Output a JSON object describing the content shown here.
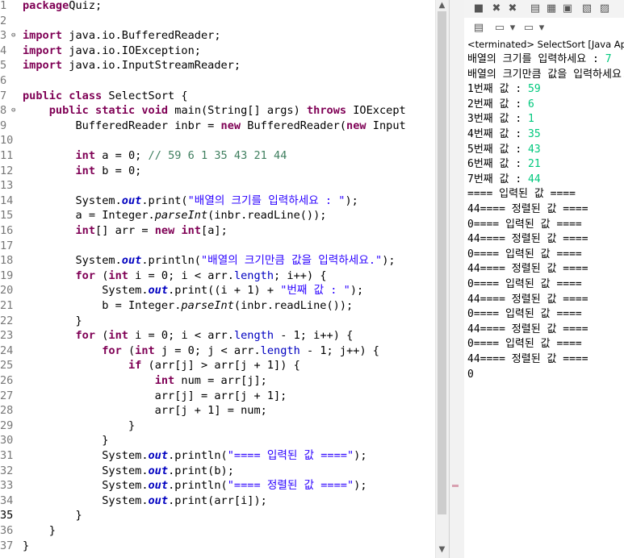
{
  "editor": {
    "lines": [
      {
        "n": "1",
        "fold": "",
        "segs": [
          [
            "kw",
            "package"
          ],
          [
            "",
            "Quiz;"
          ]
        ]
      },
      {
        "n": "2",
        "fold": "",
        "segs": []
      },
      {
        "n": "3",
        "fold": "⊖",
        "segs": [
          [
            "kw",
            "import"
          ],
          [
            "",
            " java.io.BufferedReader;"
          ]
        ]
      },
      {
        "n": "4",
        "fold": "",
        "segs": [
          [
            "kw",
            "import"
          ],
          [
            "",
            " java.io.IOException;"
          ]
        ]
      },
      {
        "n": "5",
        "fold": "",
        "segs": [
          [
            "kw",
            "import"
          ],
          [
            "",
            " java.io.InputStreamReader;"
          ]
        ]
      },
      {
        "n": "6",
        "fold": "",
        "segs": []
      },
      {
        "n": "7",
        "fold": "",
        "segs": [
          [
            "kw",
            "public class"
          ],
          [
            "",
            " SelectSort {"
          ]
        ]
      },
      {
        "n": "8",
        "fold": "⊖",
        "segs": [
          [
            "",
            "    "
          ],
          [
            "kw",
            "public static void"
          ],
          [
            "",
            " main(String[] args) "
          ],
          [
            "kw",
            "throws"
          ],
          [
            "",
            " IOExcept"
          ]
        ]
      },
      {
        "n": "9",
        "fold": "",
        "segs": [
          [
            "",
            "        BufferedReader inbr = "
          ],
          [
            "kw",
            "new"
          ],
          [
            "",
            " BufferedReader("
          ],
          [
            "kw",
            "new"
          ],
          [
            "",
            " Input"
          ]
        ]
      },
      {
        "n": "10",
        "fold": "",
        "segs": []
      },
      {
        "n": "11",
        "fold": "",
        "segs": [
          [
            "",
            "        "
          ],
          [
            "kw",
            "int"
          ],
          [
            "",
            " a = 0; "
          ],
          [
            "cm",
            "// 59 6 1 35 43 21 44"
          ]
        ]
      },
      {
        "n": "12",
        "fold": "",
        "segs": [
          [
            "",
            "        "
          ],
          [
            "kw",
            "int"
          ],
          [
            "",
            " b = 0;"
          ]
        ]
      },
      {
        "n": "13",
        "fold": "",
        "segs": []
      },
      {
        "n": "14",
        "fold": "",
        "segs": [
          [
            "",
            "        System."
          ],
          [
            "sfld",
            "out"
          ],
          [
            "",
            ".print("
          ],
          [
            "str",
            "\"배열의 크기를 입력하세요 : \""
          ],
          [
            "",
            ");"
          ]
        ]
      },
      {
        "n": "15",
        "fold": "",
        "segs": [
          [
            "",
            "        a = Integer."
          ],
          [
            "it",
            "parseInt"
          ],
          [
            "",
            "(inbr.readLine());"
          ]
        ]
      },
      {
        "n": "16",
        "fold": "",
        "segs": [
          [
            "",
            "        "
          ],
          [
            "kw",
            "int"
          ],
          [
            "",
            "[] arr = "
          ],
          [
            "kw",
            "new int"
          ],
          [
            "",
            "[a];"
          ]
        ]
      },
      {
        "n": "17",
        "fold": "",
        "segs": []
      },
      {
        "n": "18",
        "fold": "",
        "segs": [
          [
            "",
            "        System."
          ],
          [
            "sfld",
            "out"
          ],
          [
            "",
            ".println("
          ],
          [
            "str",
            "\"배열의 크기만큼 값을 입력하세요.\""
          ],
          [
            "",
            ");"
          ]
        ]
      },
      {
        "n": "19",
        "fold": "",
        "segs": [
          [
            "",
            "        "
          ],
          [
            "kw",
            "for"
          ],
          [
            "",
            " ("
          ],
          [
            "kw",
            "int"
          ],
          [
            "",
            " i = 0; i < arr."
          ],
          [
            "fld",
            "length"
          ],
          [
            "",
            "; i++) {"
          ]
        ]
      },
      {
        "n": "20",
        "fold": "",
        "segs": [
          [
            "",
            "            System."
          ],
          [
            "sfld",
            "out"
          ],
          [
            "",
            ".print((i + 1) + "
          ],
          [
            "str",
            "\"번째 값 : \""
          ],
          [
            "",
            ");"
          ]
        ]
      },
      {
        "n": "21",
        "fold": "",
        "segs": [
          [
            "",
            "            b = Integer."
          ],
          [
            "it",
            "parseInt"
          ],
          [
            "",
            "(inbr.readLine());"
          ]
        ]
      },
      {
        "n": "22",
        "fold": "",
        "segs": [
          [
            "",
            "        }"
          ]
        ]
      },
      {
        "n": "23",
        "fold": "",
        "segs": [
          [
            "",
            "        "
          ],
          [
            "kw",
            "for"
          ],
          [
            "",
            " ("
          ],
          [
            "kw",
            "int"
          ],
          [
            "",
            " i = 0; i < arr."
          ],
          [
            "fld",
            "length"
          ],
          [
            "",
            " - 1; i++) {"
          ]
        ]
      },
      {
        "n": "24",
        "fold": "",
        "segs": [
          [
            "",
            "            "
          ],
          [
            "kw",
            "for"
          ],
          [
            "",
            " ("
          ],
          [
            "kw",
            "int"
          ],
          [
            "",
            " j = 0; j < arr."
          ],
          [
            "fld",
            "length"
          ],
          [
            "",
            " - 1; j++) {"
          ]
        ]
      },
      {
        "n": "25",
        "fold": "",
        "segs": [
          [
            "",
            "                "
          ],
          [
            "kw",
            "if"
          ],
          [
            "",
            " (arr[j] > arr[j + 1]) {"
          ]
        ]
      },
      {
        "n": "26",
        "fold": "",
        "segs": [
          [
            "",
            "                    "
          ],
          [
            "kw",
            "int"
          ],
          [
            "",
            " num = arr[j];"
          ]
        ]
      },
      {
        "n": "27",
        "fold": "",
        "segs": [
          [
            "",
            "                    arr[j] = arr[j + 1];"
          ]
        ]
      },
      {
        "n": "28",
        "fold": "",
        "segs": [
          [
            "",
            "                    arr[j + 1] = num;"
          ]
        ]
      },
      {
        "n": "29",
        "fold": "",
        "segs": [
          [
            "",
            "                }"
          ]
        ]
      },
      {
        "n": "30",
        "fold": "",
        "segs": [
          [
            "",
            "            }"
          ]
        ]
      },
      {
        "n": "31",
        "fold": "",
        "segs": [
          [
            "",
            "            System."
          ],
          [
            "sfld",
            "out"
          ],
          [
            "",
            ".println("
          ],
          [
            "str",
            "\"==== 입력된 값 ====\""
          ],
          [
            "",
            ");"
          ]
        ]
      },
      {
        "n": "32",
        "fold": "",
        "segs": [
          [
            "",
            "            System."
          ],
          [
            "sfld",
            "out"
          ],
          [
            "",
            ".print(b);"
          ]
        ]
      },
      {
        "n": "33",
        "fold": "",
        "segs": [
          [
            "",
            "            System."
          ],
          [
            "sfld",
            "out"
          ],
          [
            "",
            ".println("
          ],
          [
            "str",
            "\"==== 정렬된 값 ====\""
          ],
          [
            "",
            ");"
          ]
        ]
      },
      {
        "n": "34",
        "fold": "",
        "segs": [
          [
            "",
            "            System."
          ],
          [
            "sfld",
            "out"
          ],
          [
            "",
            ".print(arr[i]);"
          ]
        ]
      },
      {
        "n": "35",
        "fold": "",
        "segs": [
          [
            "",
            "        }"
          ]
        ]
      },
      {
        "n": "36",
        "fold": "",
        "segs": [
          [
            "",
            "    }"
          ]
        ]
      },
      {
        "n": "37",
        "fold": "",
        "segs": [
          [
            "",
            "}"
          ]
        ]
      }
    ]
  },
  "console": {
    "toolbar_icons": [
      "stop-icon",
      "remove-launch-icon",
      "remove-all-icon",
      "scroll-lock-icon",
      "word-wrap-icon",
      "pin-icon",
      "show-console-icon",
      "new-console-icon"
    ],
    "status": "<terminated> SelectSort [Java Applic",
    "lines": [
      [
        [
          "",
          "배열의 크기를 입력하세요 : "
        ],
        [
          "in",
          "7"
        ]
      ],
      [
        [
          "",
          "배열의 크기만큼 값을 입력하세요."
        ]
      ],
      [
        [
          "",
          "1번째 값 : "
        ],
        [
          "in",
          "59"
        ]
      ],
      [
        [
          "",
          "2번째 값 : "
        ],
        [
          "in",
          "6"
        ]
      ],
      [
        [
          "",
          "3번째 값 : "
        ],
        [
          "in",
          "1"
        ]
      ],
      [
        [
          "",
          "4번째 값 : "
        ],
        [
          "in",
          "35"
        ]
      ],
      [
        [
          "",
          "5번째 값 : "
        ],
        [
          "in",
          "43"
        ]
      ],
      [
        [
          "",
          "6번째 값 : "
        ],
        [
          "in",
          "21"
        ]
      ],
      [
        [
          "",
          "7번째 값 : "
        ],
        [
          "in",
          "44"
        ]
      ],
      [
        [
          "",
          "==== 입력된 값 ===="
        ]
      ],
      [
        [
          "",
          "44==== 정렬된 값 ===="
        ]
      ],
      [
        [
          "",
          "0==== 입력된 값 ===="
        ]
      ],
      [
        [
          "",
          "44==== 정렬된 값 ===="
        ]
      ],
      [
        [
          "",
          "0==== 입력된 값 ===="
        ]
      ],
      [
        [
          "",
          "44==== 정렬된 값 ===="
        ]
      ],
      [
        [
          "",
          "0==== 입력된 값 ===="
        ]
      ],
      [
        [
          "",
          "44==== 정렬된 값 ===="
        ]
      ],
      [
        [
          "",
          "0==== 입력된 값 ===="
        ]
      ],
      [
        [
          "",
          "44==== 정렬된 값 ===="
        ]
      ],
      [
        [
          "",
          "0==== 입력된 값 ===="
        ]
      ],
      [
        [
          "",
          "44==== 정렬된 값 ===="
        ]
      ],
      [
        [
          "",
          "0"
        ]
      ]
    ]
  }
}
